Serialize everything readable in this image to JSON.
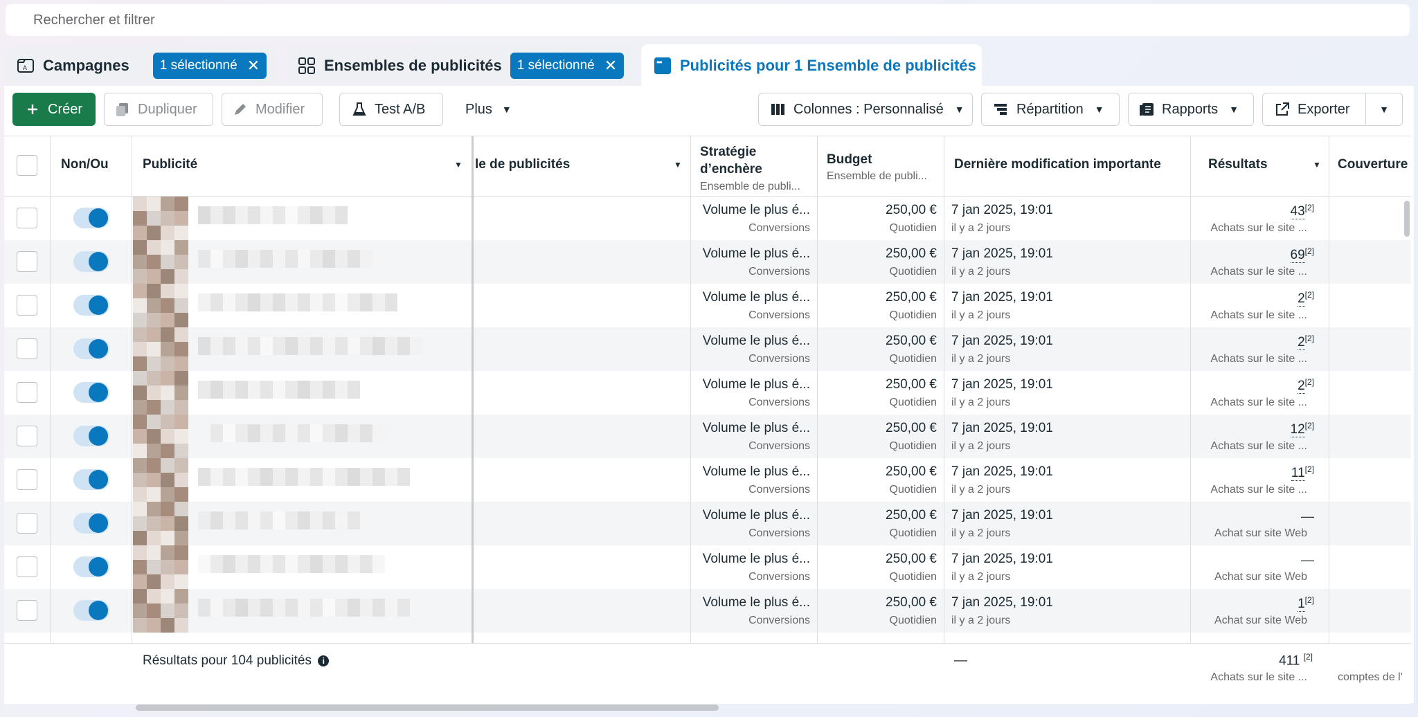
{
  "search": {
    "placeholder": "Rechercher et filtrer"
  },
  "tabs": [
    {
      "label": "Campagnes",
      "chip": "1 sélectionné",
      "icon": "campaign-icon"
    },
    {
      "label": "Ensembles de publicités",
      "chip": "1 sélectionné",
      "icon": "grid-icon"
    },
    {
      "label": "Publicités pour 1 Ensemble de publicités",
      "icon": "ad-icon"
    }
  ],
  "toolbar": {
    "create": "Créer",
    "duplicate": "Dupliquer",
    "edit": "Modifier",
    "ab_test": "Test A/B",
    "more": "Plus",
    "columns": "Colonnes : Personnalisé",
    "breakdown": "Répartition",
    "reports": "Rapports",
    "export": "Exporter"
  },
  "columns": {
    "toggle": "Non/Ou",
    "ad": "Publicité",
    "adset": "le de publicités",
    "bid": "Stratégie d’enchère",
    "bid_sub": "Ensemble de publi...",
    "budget": "Budget",
    "budget_sub": "Ensemble de publi...",
    "modified": "Dernière modification importante",
    "results": "Résultats",
    "reach": "Couverture"
  },
  "rows": [
    {
      "bid": "Volume le plus é...",
      "bid_sub": "Conversions",
      "budget": "250,00 €",
      "budget_sub": "Quotidien",
      "date": "7 jan 2025, 19:01",
      "ago": "il y a 2 jours",
      "result": "43",
      "note": "[2]",
      "result_sub": "Achats sur le site ..."
    },
    {
      "bid": "Volume le plus é...",
      "bid_sub": "Conversions",
      "budget": "250,00 €",
      "budget_sub": "Quotidien",
      "date": "7 jan 2025, 19:01",
      "ago": "il y a 2 jours",
      "result": "69",
      "note": "[2]",
      "result_sub": "Achats sur le site ..."
    },
    {
      "bid": "Volume le plus é...",
      "bid_sub": "Conversions",
      "budget": "250,00 €",
      "budget_sub": "Quotidien",
      "date": "7 jan 2025, 19:01",
      "ago": "il y a 2 jours",
      "result": "2",
      "note": "[2]",
      "result_sub": "Achats sur le site ..."
    },
    {
      "bid": "Volume le plus é...",
      "bid_sub": "Conversions",
      "budget": "250,00 €",
      "budget_sub": "Quotidien",
      "date": "7 jan 2025, 19:01",
      "ago": "il y a 2 jours",
      "result": "2",
      "note": "[2]",
      "result_sub": "Achats sur le site ..."
    },
    {
      "bid": "Volume le plus é...",
      "bid_sub": "Conversions",
      "budget": "250,00 €",
      "budget_sub": "Quotidien",
      "date": "7 jan 2025, 19:01",
      "ago": "il y a 2 jours",
      "result": "2",
      "note": "[2]",
      "result_sub": "Achats sur le site ..."
    },
    {
      "bid": "Volume le plus é...",
      "bid_sub": "Conversions",
      "budget": "250,00 €",
      "budget_sub": "Quotidien",
      "date": "7 jan 2025, 19:01",
      "ago": "il y a 2 jours",
      "result": "12",
      "note": "[2]",
      "result_sub": "Achats sur le site ..."
    },
    {
      "bid": "Volume le plus é...",
      "bid_sub": "Conversions",
      "budget": "250,00 €",
      "budget_sub": "Quotidien",
      "date": "7 jan 2025, 19:01",
      "ago": "il y a 2 jours",
      "result": "11",
      "note": "[2]",
      "result_sub": "Achats sur le site ..."
    },
    {
      "bid": "Volume le plus é...",
      "bid_sub": "Conversions",
      "budget": "250,00 €",
      "budget_sub": "Quotidien",
      "date": "7 jan 2025, 19:01",
      "ago": "il y a 2 jours",
      "result": "—",
      "note": "",
      "result_sub": "Achat sur site Web"
    },
    {
      "bid": "Volume le plus é...",
      "bid_sub": "Conversions",
      "budget": "250,00 €",
      "budget_sub": "Quotidien",
      "date": "7 jan 2025, 19:01",
      "ago": "il y a 2 jours",
      "result": "—",
      "note": "",
      "result_sub": "Achat sur site Web"
    },
    {
      "bid": "Volume le plus é...",
      "bid_sub": "Conversions",
      "budget": "250,00 €",
      "budget_sub": "Quotidien",
      "date": "7 jan 2025, 19:01",
      "ago": "il y a 2 jours",
      "result": "1",
      "note": "[2]",
      "result_sub": "Achat sur site Web"
    }
  ],
  "footer": {
    "label": "Résultats pour 104 publicités",
    "date": "—",
    "total": "411",
    "total_note": "[2]",
    "total_sub": "Achats sur le site ...",
    "reach_sub": "comptes de l'"
  },
  "colors": {
    "accent": "#0a78be",
    "create": "#1a7b4a"
  }
}
